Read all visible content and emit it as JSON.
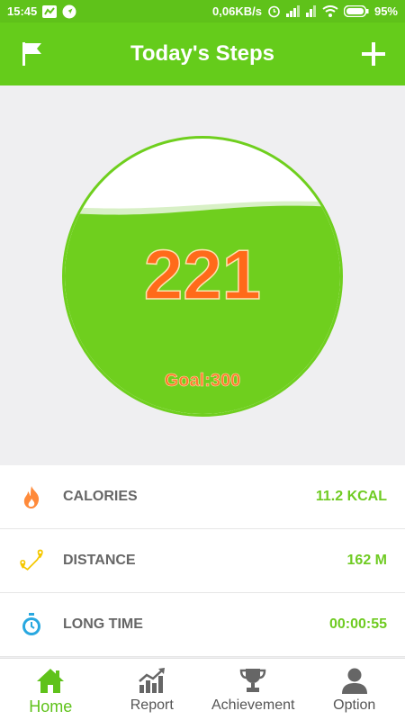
{
  "status_bar": {
    "time": "15:45",
    "network_speed": "0,06KB/s",
    "battery": "95%"
  },
  "header": {
    "title": "Today's Steps",
    "left_icon": "flag-icon",
    "right_icon": "plus-icon"
  },
  "progress": {
    "steps": "221",
    "goal_text": "Goal:300",
    "fill_fraction": 0.74
  },
  "stats": [
    {
      "icon": "flame-icon",
      "label": "CALORIES",
      "value": "11.2 KCAL"
    },
    {
      "icon": "route-pin-icon",
      "label": "DISTANCE",
      "value": "162 M"
    },
    {
      "icon": "stopwatch-icon",
      "label": "LONG TIME",
      "value": "00:00:55"
    }
  ],
  "nav": [
    {
      "icon": "home-icon",
      "label": "Home",
      "active": true
    },
    {
      "icon": "report-chart-icon",
      "label": "Report",
      "active": false
    },
    {
      "icon": "trophy-icon",
      "label": "Achievement",
      "active": false
    },
    {
      "icon": "user-icon",
      "label": "Option",
      "active": false
    }
  ],
  "colors": {
    "brand_green": "#65cc1b",
    "step_orange": "#ff6a1a",
    "value_green": "#6fcb22"
  }
}
